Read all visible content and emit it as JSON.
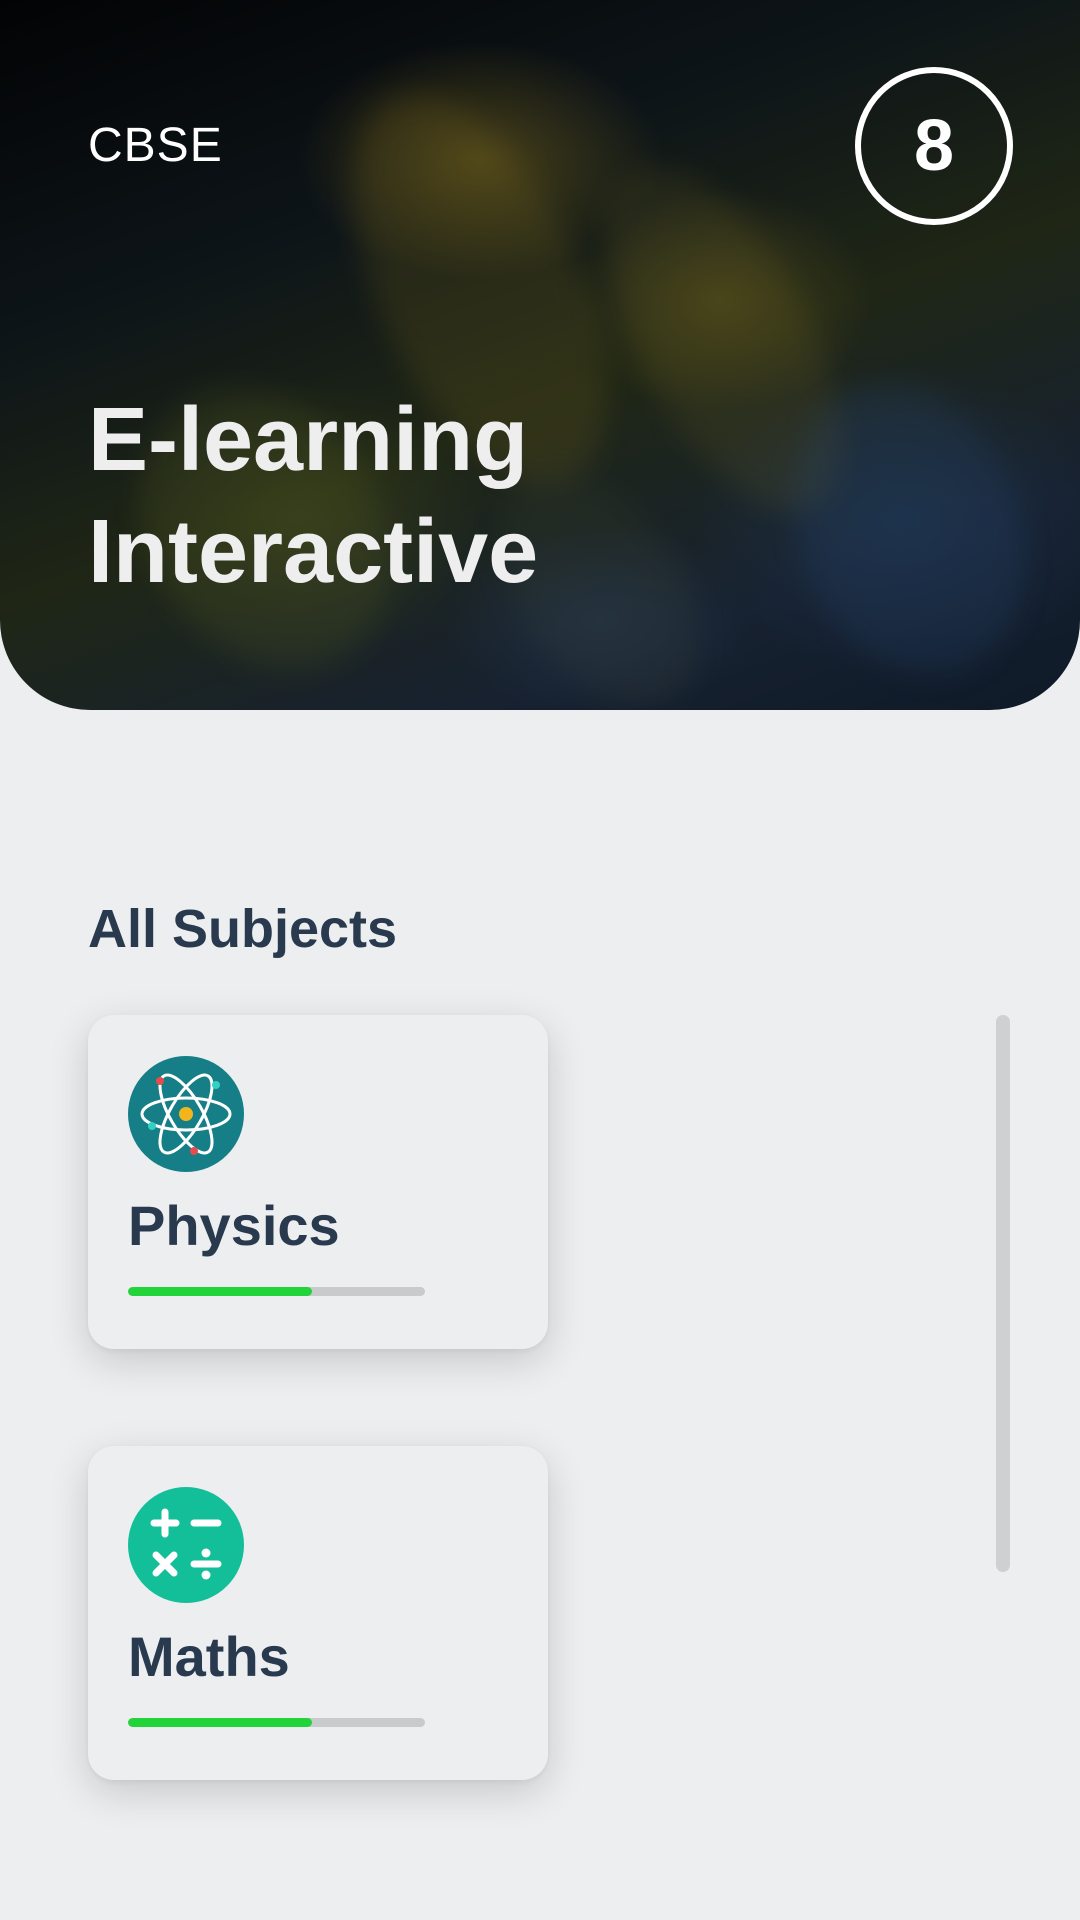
{
  "header": {
    "board": "CBSE",
    "grade": "8",
    "title": "E-learning\nInteractive"
  },
  "section": {
    "title": "All Subjects"
  },
  "subjects": [
    {
      "label": "Physics",
      "icon": "atom-icon",
      "icon_color": "#167e87",
      "progress": 0.62
    },
    {
      "label": "Maths",
      "icon": "math-operators-icon",
      "icon_color": "#13bf98",
      "progress": 0.62
    }
  ],
  "colors": {
    "background": "#eceef0",
    "heading": "#2a3a4e",
    "progress_fill": "#22d43a",
    "progress_track": "#c9cacb"
  }
}
